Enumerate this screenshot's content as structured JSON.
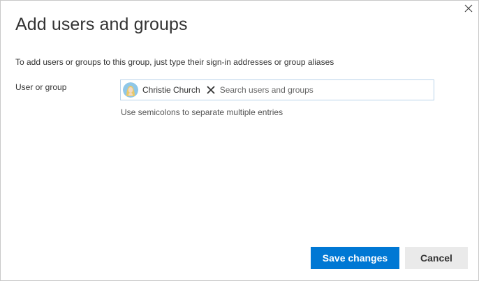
{
  "dialog": {
    "title": "Add users and groups",
    "instructions": "To add users or groups to this group, just type their sign-in addresses or group aliases",
    "field_label": "User or group",
    "picker": {
      "selected": [
        {
          "name": "Christie Church",
          "avatar_icon": "user-avatar"
        }
      ],
      "placeholder": "Search users and groups",
      "value": ""
    },
    "hint": "Use semicolons to separate multiple entries",
    "buttons": {
      "save_label": "Save changes",
      "cancel_label": "Cancel"
    },
    "colors": {
      "primary": "#0078d4",
      "secondary_bg": "#eaeaea",
      "picker_border": "#b9d3ea"
    }
  }
}
